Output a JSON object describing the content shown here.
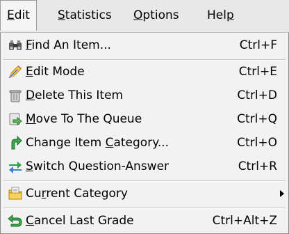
{
  "menubar": {
    "items": [
      {
        "pre": "",
        "u": "E",
        "post": "dit"
      },
      {
        "pre": "",
        "u": "S",
        "post": "tatistics"
      },
      {
        "pre": "",
        "u": "O",
        "post": "ptions"
      },
      {
        "pre": "Hel",
        "u": "p",
        "post": ""
      }
    ]
  },
  "menu": {
    "items": [
      {
        "icon": "binoculars-icon",
        "pre": "",
        "u": "F",
        "post": "ind An Item...",
        "shortcut": "Ctrl+F"
      },
      {
        "icon": "pencil-icon",
        "pre": "",
        "u": "E",
        "post": "dit Mode",
        "shortcut": "Ctrl+E"
      },
      {
        "icon": "trash-icon",
        "pre": "",
        "u": "D",
        "post": "elete This Item",
        "shortcut": "Ctrl+D"
      },
      {
        "icon": "move-queue-icon",
        "pre": "",
        "u": "M",
        "post": "ove To The Queue",
        "shortcut": "Ctrl+Q"
      },
      {
        "icon": "curved-arrow-icon",
        "pre": "Change Item ",
        "u": "C",
        "post": "ategory...",
        "shortcut": "Ctrl+O"
      },
      {
        "icon": "swap-icon",
        "pre": "",
        "u": "S",
        "post": "witch Question-Answer",
        "shortcut": "Ctrl+R"
      },
      {
        "icon": "folder-icon",
        "pre": "Cu",
        "u": "r",
        "post": "rent Category",
        "shortcut": ""
      },
      {
        "icon": "undo-icon",
        "pre": "",
        "u": "C",
        "post": "ancel Last Grade",
        "shortcut": "Ctrl+Alt+Z"
      }
    ]
  }
}
